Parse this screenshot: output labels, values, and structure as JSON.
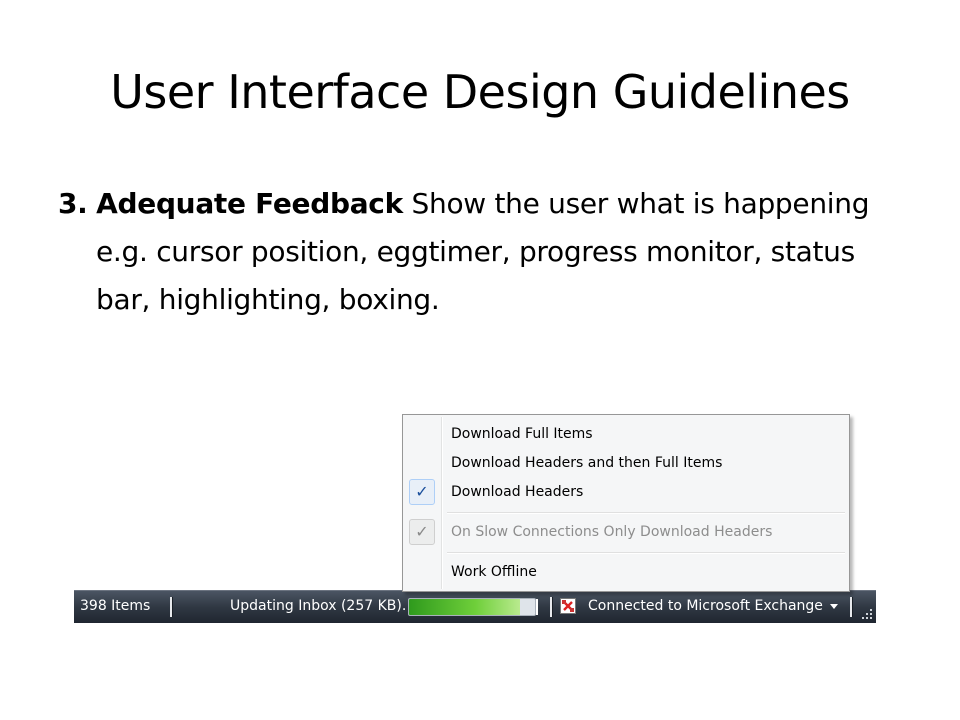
{
  "slide": {
    "title": "User Interface Design Guidelines",
    "bullet_number": "3.",
    "bullet_heading": "Adequate Feedback",
    "bullet_text": "Show the user what is happening e.g. cursor position, eggtimer, progress monitor, status bar, highlighting, boxing."
  },
  "menu": {
    "items": [
      {
        "label": "Download Full Items",
        "checked": false,
        "enabled": true
      },
      {
        "label": "Download Headers and then Full Items",
        "checked": false,
        "enabled": true
      },
      {
        "label": "Download Headers",
        "checked": true,
        "enabled": true
      },
      {
        "label": "On Slow Connections Only Download Headers",
        "checked": true,
        "enabled": false
      },
      {
        "label": "Work Offline",
        "checked": false,
        "enabled": true
      }
    ],
    "check_glyph": "✓"
  },
  "statusbar": {
    "item_count": "398 Items",
    "updating": "Updating Inbox (257 KB).",
    "progress_fraction": 0.88,
    "connection": "Connected to Microsoft Exchange",
    "connection_icon": "exchange-icon",
    "dropdown_icon": "chevron-down-icon"
  },
  "colors": {
    "statusbar_bg": "#303843",
    "progress_fill": "#6fcf3a",
    "check_active": "#1b4f9c"
  }
}
